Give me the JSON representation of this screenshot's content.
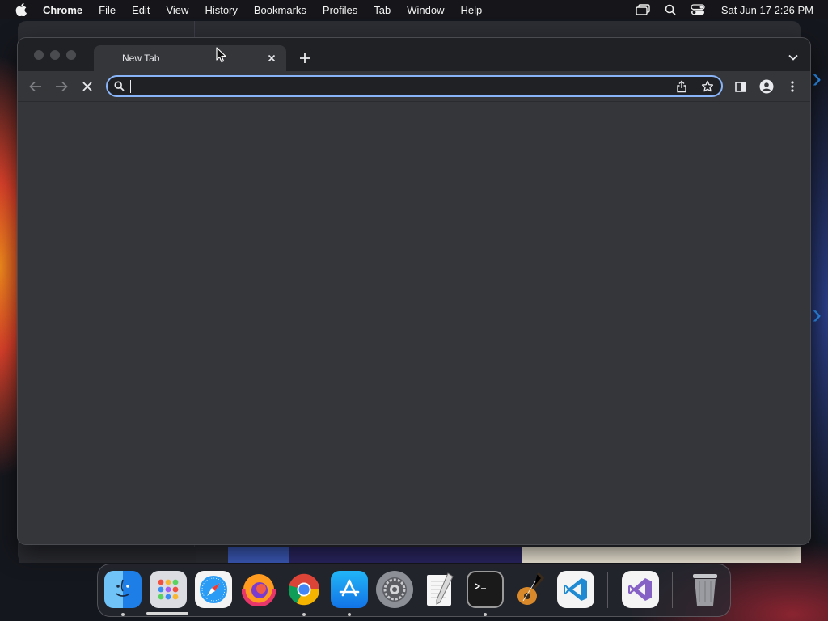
{
  "menubar": {
    "app_name": "Chrome",
    "items": [
      "File",
      "Edit",
      "View",
      "History",
      "Bookmarks",
      "Profiles",
      "Tab",
      "Window",
      "Help"
    ],
    "clock": "Sat Jun 17  2:26 PM"
  },
  "browser": {
    "tab": {
      "title": "New Tab"
    },
    "omnibox": {
      "value": "",
      "placeholder": ""
    }
  },
  "dock": {
    "apps": [
      "Finder",
      "Launchpad",
      "Safari",
      "Firefox",
      "Google Chrome",
      "App Store",
      "System Settings",
      "TextEdit",
      "Terminal",
      "GarageBand",
      "Visual Studio Code",
      "Visual Studio",
      "Trash"
    ]
  },
  "colors": {
    "accent": "#8ab4f8",
    "window_bg": "#35363a",
    "tabstrip_bg": "#202124"
  }
}
